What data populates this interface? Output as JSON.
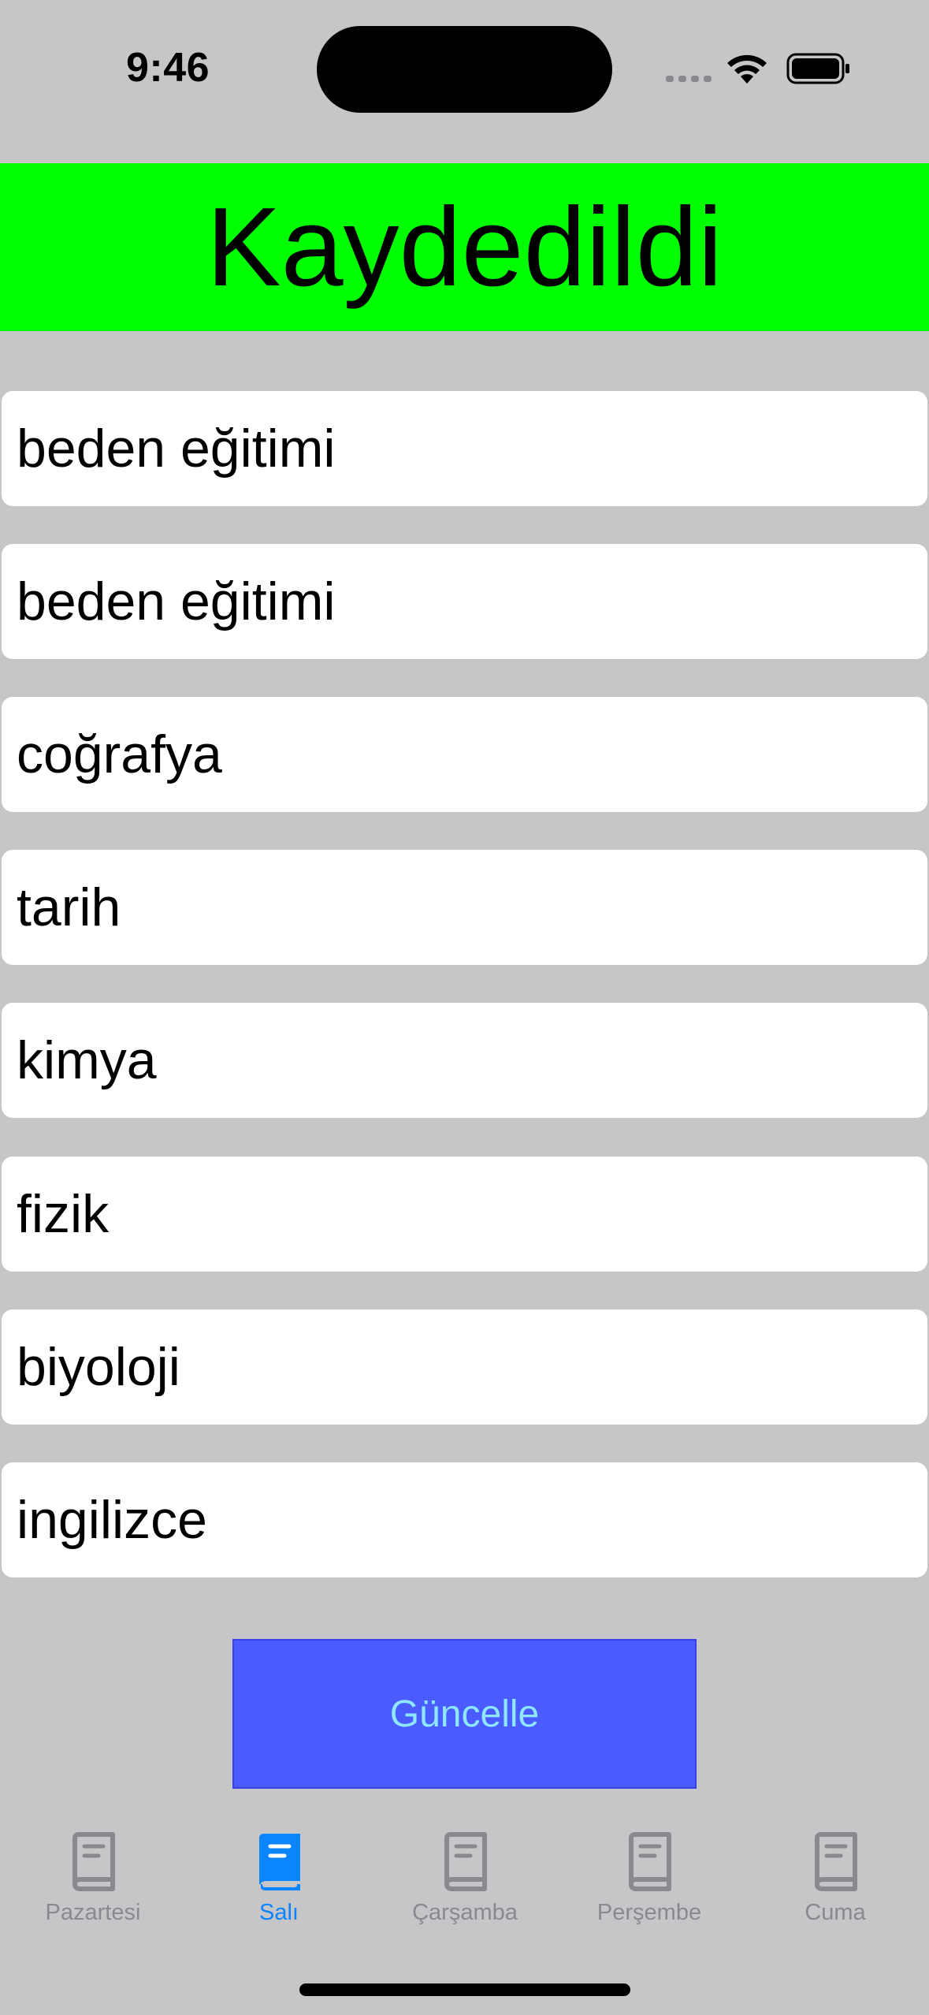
{
  "status_bar": {
    "time": "9:46"
  },
  "banner": {
    "text": "Kaydedildi",
    "color": "#00ff00"
  },
  "fields": [
    {
      "value": "beden eğitimi"
    },
    {
      "value": "beden eğitimi"
    },
    {
      "value": "coğrafya"
    },
    {
      "value": "tarih"
    },
    {
      "value": "kimya"
    },
    {
      "value": "fizik"
    },
    {
      "value": "biyoloji"
    },
    {
      "value": "ingilizce"
    }
  ],
  "update_button": {
    "label": "Güncelle",
    "color": "#4a5cff"
  },
  "tabs": [
    {
      "label": "Pazartesi",
      "icon": "book-icon",
      "active": false
    },
    {
      "label": "Salı",
      "icon": "book-icon",
      "active": true
    },
    {
      "label": "Çarşamba",
      "icon": "book-icon",
      "active": false
    },
    {
      "label": "Perşembe",
      "icon": "book-icon",
      "active": false
    },
    {
      "label": "Cuma",
      "icon": "book-icon",
      "active": false
    }
  ]
}
